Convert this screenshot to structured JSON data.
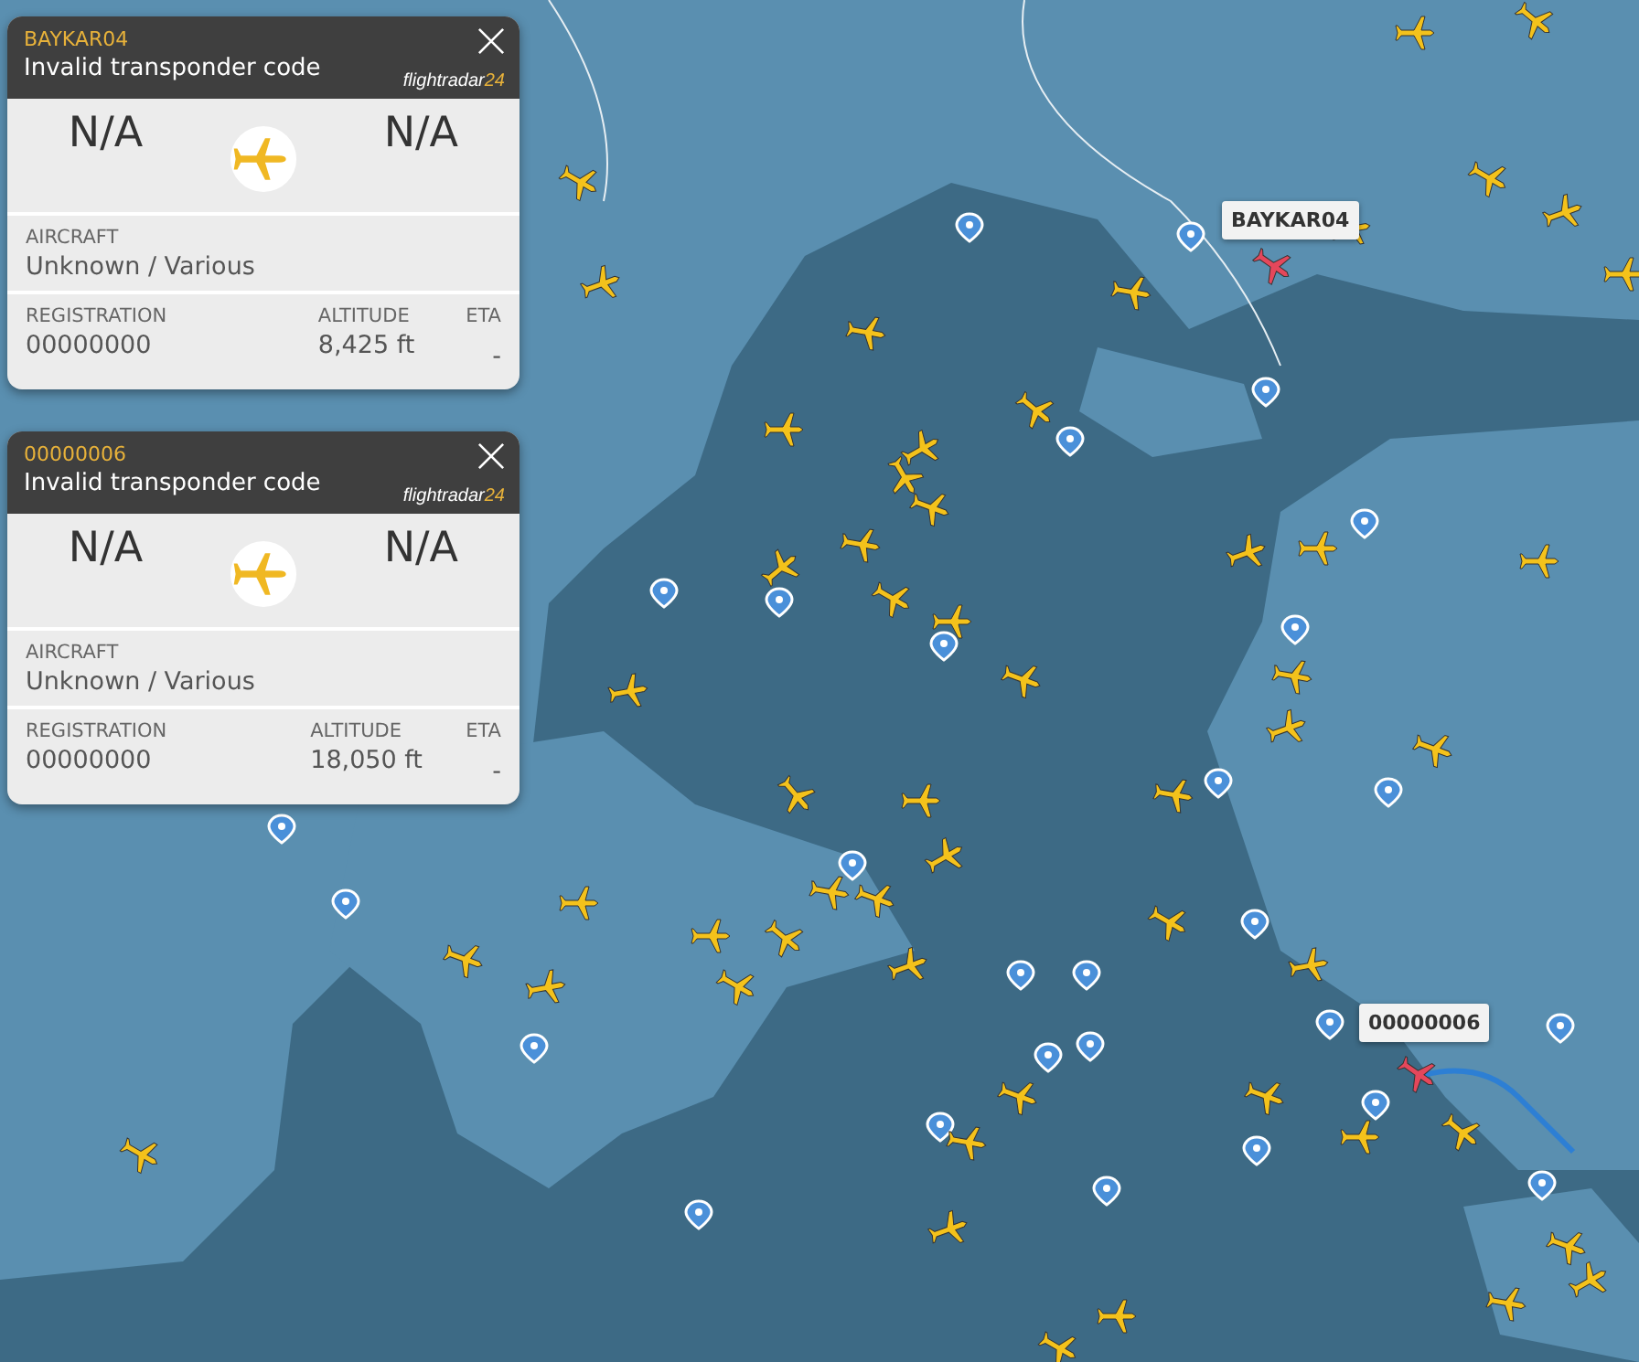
{
  "flight_cards": [
    {
      "callsign": "BAYKAR04",
      "status": "Invalid transponder code",
      "logo": {
        "name": "flightradar",
        "number": "24"
      },
      "origin": "N/A",
      "destination": "N/A",
      "aircraft_label": "AIRCRAFT",
      "aircraft": "Unknown / Various",
      "registration_label": "REGISTRATION",
      "registration": "00000000",
      "altitude_label": "ALTITUDE",
      "altitude": "8,425 ft",
      "eta_label": "ETA",
      "eta": "-"
    },
    {
      "callsign": "00000006",
      "status": "Invalid transponder code",
      "logo": {
        "name": "flightradar",
        "number": "24"
      },
      "origin": "N/A",
      "destination": "N/A",
      "aircraft_label": "AIRCRAFT",
      "aircraft": "Unknown / Various",
      "registration_label": "REGISTRATION",
      "registration": "00000000",
      "altitude_label": "ALTITUDE",
      "altitude": "18,050 ft",
      "eta_label": "ETA",
      "eta": "-"
    }
  ],
  "map_callouts": [
    {
      "label": "BAYKAR04"
    },
    {
      "label": "00000006"
    }
  ]
}
